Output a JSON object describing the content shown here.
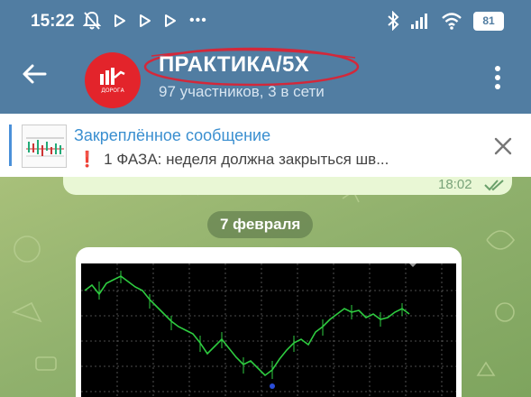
{
  "status_bar": {
    "time": "15:22",
    "battery": "81",
    "more": "•••"
  },
  "header": {
    "title": "ПРАКТИКА/5X",
    "subtitle": "97 участников, 3 в сети",
    "avatar_text": "ДОРОГА",
    "accent_color": "#517da2",
    "avatar_color": "#e3242b",
    "highlight_color": "#d3283a"
  },
  "pinned": {
    "title": "Закреплённое сообщение",
    "marker": "❗",
    "text": "1 ФАЗА: неделя должна закрыться шв..."
  },
  "chat": {
    "prev_message_time": "18:02",
    "date_separator": "7 февраля"
  }
}
